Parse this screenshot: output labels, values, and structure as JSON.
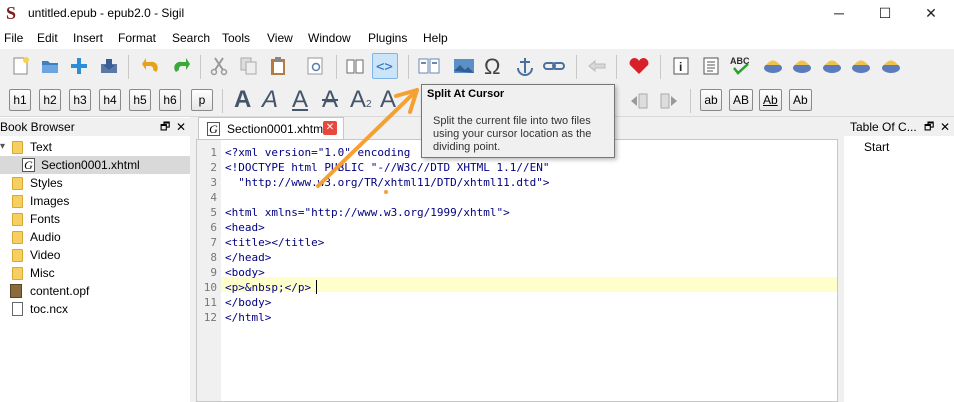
{
  "window": {
    "title": "untitled.epub - epub2.0 - Sigil",
    "minimize": "─",
    "maximize": "☐",
    "close": "✕"
  },
  "menu": [
    "File",
    "Edit",
    "Insert",
    "Format",
    "Search",
    "Tools",
    "View",
    "Window",
    "Plugins",
    "Help"
  ],
  "menu_mnemonics": [
    "F",
    "E",
    "I",
    "m",
    "S",
    "T",
    "V",
    "W",
    "",
    "H"
  ],
  "toolbar2": {
    "headings": [
      "h1",
      "h2",
      "h3",
      "h4",
      "h5",
      "h6",
      "p"
    ],
    "case_buttons": [
      "ab",
      "AB",
      "Ab",
      "Ab"
    ]
  },
  "tooltip": {
    "title": "Split At Cursor",
    "body": "Split the current file into two files using your cursor location as the dividing point."
  },
  "book_browser": {
    "title": "Book Browser",
    "float_icon": "🗗",
    "close_icon": "✕",
    "items": [
      {
        "label": "Text",
        "expanded": "▾"
      },
      {
        "label": "Section0001.xhtml"
      },
      {
        "label": "Styles"
      },
      {
        "label": "Images"
      },
      {
        "label": "Fonts"
      },
      {
        "label": "Audio"
      },
      {
        "label": "Video"
      },
      {
        "label": "Misc"
      },
      {
        "label": "content.opf"
      },
      {
        "label": "toc.ncx"
      }
    ]
  },
  "editor": {
    "tab_label": "Section0001.xhtml",
    "highlight_color": "#ffffcc",
    "lines": [
      {
        "n": "1",
        "text": "<?xml version=\"1.0\" encoding"
      },
      {
        "n": "2",
        "text": "<!DOCTYPE html PUBLIC \"-//W3C//DTD XHTML 1.1//EN\""
      },
      {
        "n": "3",
        "text": "  \"http://www.w3.org/TR/xhtml11/DTD/xhtml11.dtd\">"
      },
      {
        "n": "4",
        "text": ""
      },
      {
        "n": "5",
        "text": "<html xmlns=\"http://www.w3.org/1999/xhtml\">"
      },
      {
        "n": "6",
        "text": "<head>"
      },
      {
        "n": "7",
        "text": "<title></title>"
      },
      {
        "n": "8",
        "text": "</head>"
      },
      {
        "n": "9",
        "text": "<body>"
      },
      {
        "n": "10",
        "text": "<p>&nbsp;</p>"
      },
      {
        "n": "11",
        "text": "</body>"
      },
      {
        "n": "12",
        "text": "</html>"
      }
    ]
  },
  "toc": {
    "title": "Table Of C...",
    "float_icon": "🗗",
    "close_icon": "✕",
    "items": [
      "Start"
    ]
  },
  "annotation": {
    "arrow_color": "#f5a030"
  }
}
